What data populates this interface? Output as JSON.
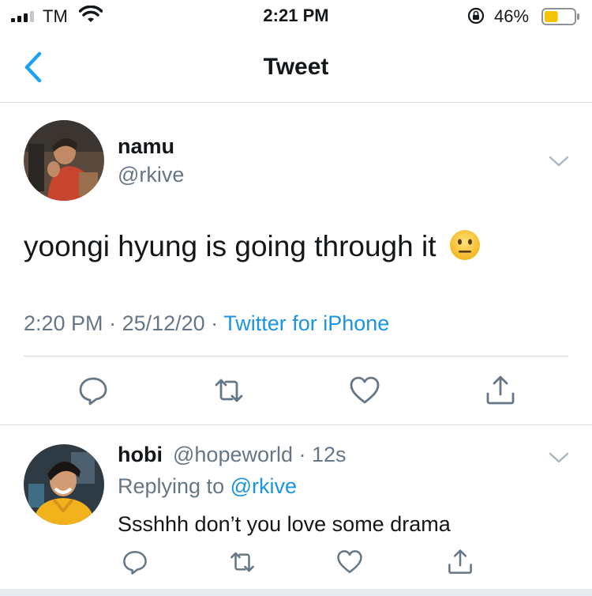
{
  "status_bar": {
    "carrier": "TM",
    "time": "2:21 PM",
    "battery_percent": "46%",
    "battery_level": 0.46,
    "battery_color": "#f5c400",
    "icons": [
      "signal-icon",
      "wifi-icon",
      "rotation-lock-icon",
      "battery-icon"
    ]
  },
  "nav": {
    "title": "Tweet",
    "back_icon": "chevron-left-icon",
    "accent": "#1da1f2"
  },
  "tweet": {
    "display_name": "namu",
    "handle": "@rkive",
    "text": "yoongi hyung is going through it",
    "emoji": "neutral-face-emoji",
    "time": "2:20 PM",
    "date": "25/12/20",
    "source": "Twitter for iPhone",
    "sep": " · ",
    "actions": [
      "reply-icon",
      "retweet-icon",
      "like-icon",
      "share-icon"
    ]
  },
  "reply": {
    "display_name": "hobi",
    "handle_time": "@hopeworld · 12s",
    "replying_prefix": "Replying to ",
    "replying_to": "@rkive",
    "text": "Ssshhh don’t you love some drama",
    "actions": [
      "reply-icon",
      "retweet-icon",
      "like-icon",
      "share-icon"
    ]
  },
  "colors": {
    "text_primary": "#14171a",
    "text_secondary": "#657786",
    "link": "#1b95e0",
    "divider": "#d6d9dc"
  }
}
